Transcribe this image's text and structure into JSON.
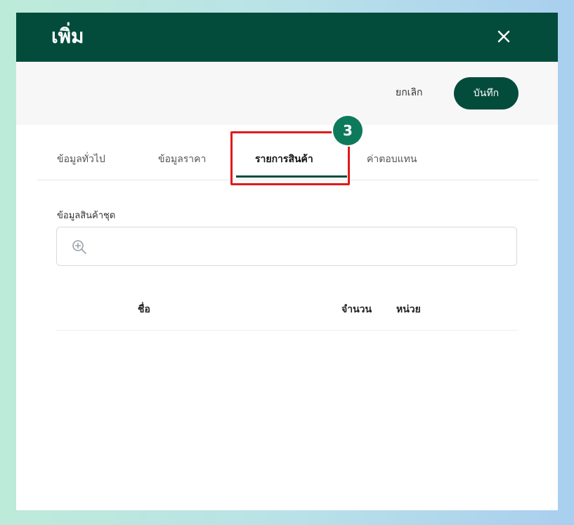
{
  "dialog": {
    "title": "เพิ่ม",
    "close_icon": "close-icon"
  },
  "toolbar": {
    "cancel_label": "ยกเลิก",
    "save_label": "บันทึก"
  },
  "tabs": [
    {
      "label": "ข้อมูลทั่วไป",
      "active": false
    },
    {
      "label": "ข้อมูลราคา",
      "active": false
    },
    {
      "label": "รายการสินค้า",
      "active": true
    },
    {
      "label": "ค่าตอบแทน",
      "active": false
    }
  ],
  "annotation": {
    "step_number": "3",
    "highlight_color": "#e01b1b"
  },
  "bundle": {
    "section_label": "ข้อมูลสินค้าชุด",
    "search_placeholder": "",
    "search_icon": "zoom-in-icon"
  },
  "table": {
    "columns": [
      "ชื่อ",
      "จำนวน",
      "หน่วย"
    ],
    "rows": []
  },
  "colors": {
    "primary": "#034c3c",
    "accent_badge": "#0e7a5c"
  }
}
